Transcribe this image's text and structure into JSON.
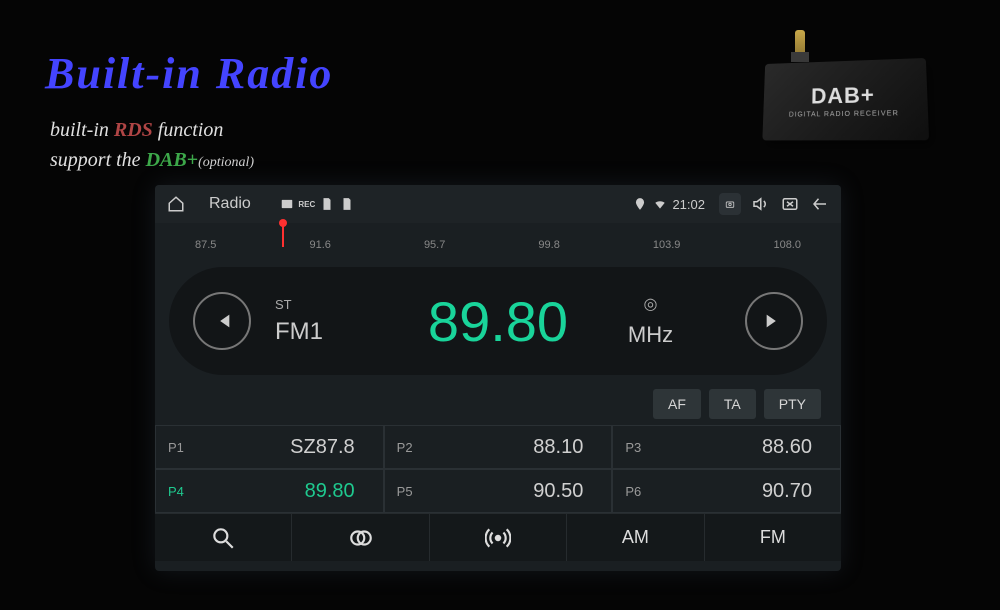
{
  "title": "Built-in Radio",
  "subtitle": {
    "line1_prefix": "built-in ",
    "line1_accent": "RDS",
    "line1_suffix": " function",
    "line2_prefix": "support the ",
    "line2_accent": "DAB+",
    "line2_suffix": "(optional)"
  },
  "dab_device": {
    "label": "DAB+",
    "sublabel": "DIGITAL RADIO RECEIVER"
  },
  "statusbar": {
    "app_title": "Radio",
    "time": "21:02"
  },
  "dial": {
    "ticks": [
      "87.5",
      "91.6",
      "95.7",
      "99.8",
      "103.9",
      "108.0"
    ]
  },
  "tuner": {
    "st": "ST",
    "band": "FM1",
    "frequency": "89.80",
    "stereo_glyph": "⊕",
    "unit": "MHz"
  },
  "options": [
    "AF",
    "TA",
    "PTY"
  ],
  "presets": [
    {
      "num": "P1",
      "val": "SZ87.8",
      "active": false
    },
    {
      "num": "P2",
      "val": "88.10",
      "active": false
    },
    {
      "num": "P3",
      "val": "88.60",
      "active": false
    },
    {
      "num": "P4",
      "val": "89.80",
      "active": true
    },
    {
      "num": "P5",
      "val": "90.50",
      "active": false
    },
    {
      "num": "P6",
      "val": "90.70",
      "active": false
    }
  ],
  "bottombar": {
    "am": "AM",
    "fm": "FM"
  }
}
